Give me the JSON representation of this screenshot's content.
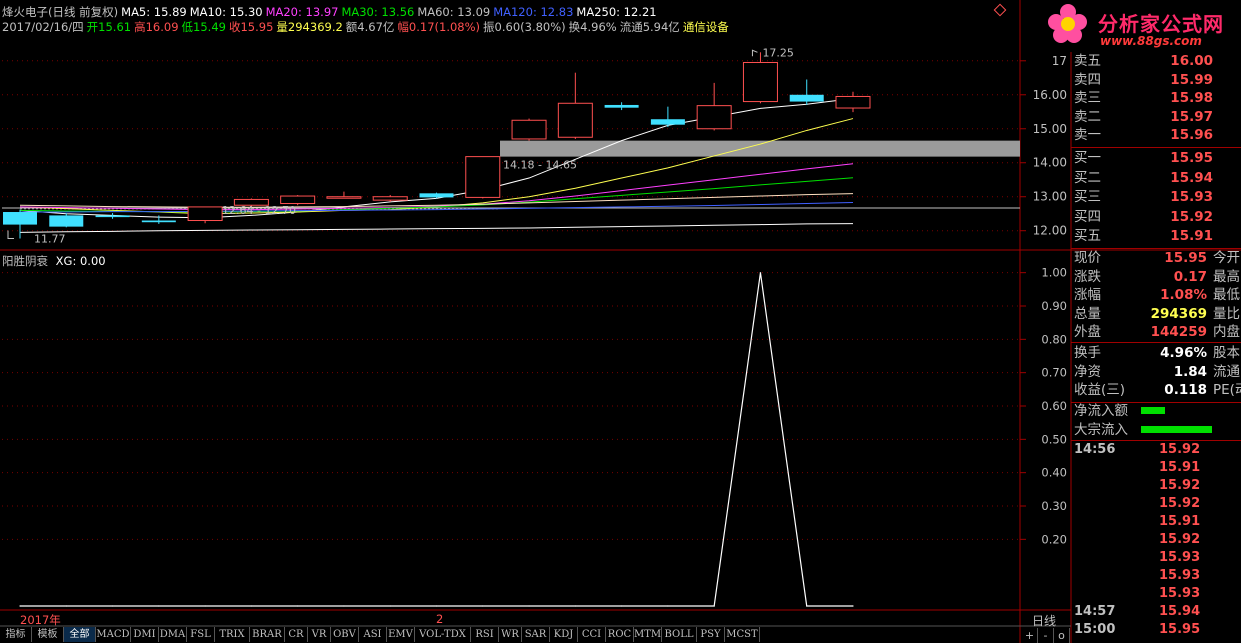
{
  "header": {
    "line1": [
      {
        "text": "烽火电子(日线 前复权)",
        "color": "#c0c0c0"
      },
      {
        "text": "MA5: 15.89",
        "color": "#ffffff"
      },
      {
        "text": "MA10: 15.30",
        "color": "#ffffff"
      },
      {
        "text": "MA20: 13.97",
        "color": "#ff40ff"
      },
      {
        "text": "MA30: 13.56",
        "color": "#00e000"
      },
      {
        "text": "MA60: 13.09",
        "color": "#c0c0c0"
      },
      {
        "text": "MA120: 12.83",
        "color": "#4060ff"
      },
      {
        "text": "MA250: 12.21",
        "color": "#ffffff"
      }
    ],
    "line2": [
      {
        "text": "2017/02/16/四",
        "color": "#c0c0c0"
      },
      {
        "text": "开15.61",
        "color": "#00e000"
      },
      {
        "text": "高16.09",
        "color": "#ff5050"
      },
      {
        "text": "低15.49",
        "color": "#00e000"
      },
      {
        "text": "收15.95",
        "color": "#ff5050"
      },
      {
        "text": "量294369.2",
        "color": "#ffff50"
      },
      {
        "text": "额4.67亿",
        "color": "#c0c0c0"
      },
      {
        "text": "幅0.17(1.08%)",
        "color": "#ff5050"
      },
      {
        "text": "振0.60(3.80%)",
        "color": "#c0c0c0"
      },
      {
        "text": "换4.96%",
        "color": "#c0c0c0"
      },
      {
        "text": "流通5.94亿",
        "color": "#c0c0c0"
      },
      {
        "text": "通信设备",
        "color": "#ffff50"
      }
    ]
  },
  "logo": {
    "title": "分析家公式网",
    "url": "www.88gs.com"
  },
  "price_chart": {
    "ylim": [
      11.55,
      17.7
    ],
    "y_ticks": [
      "17",
      "16.00",
      "15.00",
      "14.00",
      "13.00",
      "12.00"
    ],
    "y_tick_values": [
      17,
      16,
      15,
      14,
      13,
      12
    ],
    "annotations": {
      "high": "17.25",
      "low": "11.77",
      "zone1": "14.18 - 14.65",
      "zone2": "12.64 - 12.70"
    },
    "zone_upper": [
      14.18,
      14.65
    ],
    "zone_lower": [
      12.64,
      12.7
    ],
    "ref_line": 12.67,
    "candles": [
      {
        "o": 12.55,
        "h": 12.62,
        "l": 11.77,
        "c": 12.18
      },
      {
        "o": 12.45,
        "h": 12.52,
        "l": 12.1,
        "c": 12.12
      },
      {
        "o": 12.45,
        "h": 12.52,
        "l": 12.35,
        "c": 12.4
      },
      {
        "o": 12.3,
        "h": 12.45,
        "l": 12.2,
        "c": 12.25
      },
      {
        "o": 12.3,
        "h": 12.7,
        "l": 12.22,
        "c": 12.7
      },
      {
        "o": 12.75,
        "h": 12.95,
        "l": 12.7,
        "c": 12.92
      },
      {
        "o": 12.8,
        "h": 13.05,
        "l": 12.75,
        "c": 13.02
      },
      {
        "o": 13.0,
        "h": 13.15,
        "l": 12.95,
        "c": 13.0
      },
      {
        "o": 12.9,
        "h": 13.05,
        "l": 12.85,
        "c": 13.0
      },
      {
        "o": 13.1,
        "h": 13.12,
        "l": 12.95,
        "c": 12.98
      },
      {
        "o": 12.98,
        "h": 14.18,
        "l": 12.95,
        "c": 14.18
      },
      {
        "o": 14.7,
        "h": 15.3,
        "l": 14.65,
        "c": 15.25
      },
      {
        "o": 14.75,
        "h": 16.65,
        "l": 14.7,
        "c": 15.75
      },
      {
        "o": 15.7,
        "h": 15.78,
        "l": 15.55,
        "c": 15.62
      },
      {
        "o": 15.28,
        "h": 15.65,
        "l": 15.05,
        "c": 15.12
      },
      {
        "o": 15.0,
        "h": 16.35,
        "l": 14.95,
        "c": 15.68
      },
      {
        "o": 15.8,
        "h": 17.25,
        "l": 15.75,
        "c": 16.95
      },
      {
        "o": 16.0,
        "h": 16.45,
        "l": 15.7,
        "c": 15.8
      },
      {
        "o": 15.61,
        "h": 16.09,
        "l": 15.49,
        "c": 15.95
      }
    ],
    "ma": [
      {
        "name": "MA5",
        "color": "#ffffff",
        "values": [
          12.6,
          12.5,
          12.45,
          12.4,
          12.38,
          12.45,
          12.55,
          12.7,
          12.85,
          12.95,
          13.2,
          13.55,
          14.1,
          14.65,
          15.1,
          15.35,
          15.6,
          15.72,
          15.89
        ]
      },
      {
        "name": "MA10",
        "color": "#ffff50",
        "values": [
          12.7,
          12.65,
          12.6,
          12.55,
          12.5,
          12.52,
          12.55,
          12.6,
          12.62,
          12.7,
          12.82,
          13.0,
          13.25,
          13.55,
          13.85,
          14.2,
          14.55,
          14.95,
          15.3
        ]
      },
      {
        "name": "MA20",
        "color": "#ff40ff",
        "values": [
          12.7,
          12.68,
          12.66,
          12.64,
          12.62,
          12.62,
          12.64,
          12.66,
          12.68,
          12.72,
          12.78,
          12.88,
          13.02,
          13.18,
          13.34,
          13.5,
          13.66,
          13.82,
          13.97
        ]
      },
      {
        "name": "MA30",
        "color": "#00e000",
        "values": [
          12.6,
          12.58,
          12.57,
          12.56,
          12.55,
          12.56,
          12.58,
          12.62,
          12.66,
          12.7,
          12.76,
          12.84,
          12.94,
          13.04,
          13.14,
          13.24,
          13.35,
          13.45,
          13.56
        ]
      },
      {
        "name": "MA60",
        "color": "#ffe0c0",
        "values": [
          12.75,
          12.73,
          12.71,
          12.7,
          12.69,
          12.69,
          12.7,
          12.71,
          12.73,
          12.75,
          12.78,
          12.82,
          12.86,
          12.9,
          12.94,
          12.98,
          13.02,
          13.06,
          13.09
        ]
      },
      {
        "name": "MA120",
        "color": "#4060ff",
        "values": [
          12.55,
          12.55,
          12.56,
          12.56,
          12.57,
          12.58,
          12.59,
          12.6,
          12.61,
          12.62,
          12.64,
          12.66,
          12.68,
          12.7,
          12.72,
          12.74,
          12.77,
          12.8,
          12.83
        ]
      },
      {
        "name": "MA250",
        "color": "#ffffff",
        "values": [
          11.95,
          11.97,
          11.98,
          12.0,
          12.01,
          12.02,
          12.03,
          12.04,
          12.05,
          12.06,
          12.07,
          12.08,
          12.1,
          12.12,
          12.14,
          12.16,
          12.18,
          12.2,
          12.21
        ]
      }
    ]
  },
  "indicator": {
    "title": "阳胜阴衰",
    "xg_label": "XG: 0.00",
    "ylim": [
      0,
      1.05
    ],
    "y_ticks": [
      "1.00",
      "0.90",
      "0.80",
      "0.70",
      "0.60",
      "0.50",
      "0.40",
      "0.30",
      "0.20"
    ],
    "y_tick_values": [
      1.0,
      0.9,
      0.8,
      0.7,
      0.6,
      0.5,
      0.4,
      0.3,
      0.2
    ],
    "values": [
      0,
      0,
      0,
      0,
      0,
      0,
      0,
      0,
      0,
      0,
      0,
      0,
      0,
      0,
      0,
      0,
      1,
      0,
      0
    ]
  },
  "time_axis": {
    "year": "2017年",
    "month": "2",
    "period": "日线"
  },
  "tabs": [
    "指标",
    "模板",
    "全部",
    "MACD",
    "DMI",
    "DMA",
    "FSL",
    "TRIX",
    "BRAR",
    "CR",
    "VR",
    "OBV",
    "ASI",
    "EMV",
    "VOL-TDX",
    "RSI",
    "WR",
    "SAR",
    "KDJ",
    "CCI",
    "ROC",
    "MTM",
    "BOLL",
    "PSY",
    "MCST"
  ],
  "active_tab": "全部",
  "bottom_controls": [
    "+",
    "-",
    "o"
  ],
  "order_book": {
    "sell": [
      {
        "label": "卖五",
        "price": "16.00"
      },
      {
        "label": "卖四",
        "price": "15.99"
      },
      {
        "label": "卖三",
        "price": "15.98"
      },
      {
        "label": "卖二",
        "price": "15.97"
      },
      {
        "label": "卖一",
        "price": "15.96"
      }
    ],
    "buy": [
      {
        "label": "买一",
        "price": "15.95"
      },
      {
        "label": "买二",
        "price": "15.94"
      },
      {
        "label": "买三",
        "price": "15.93"
      },
      {
        "label": "买四",
        "price": "15.92"
      },
      {
        "label": "买五",
        "price": "15.91"
      }
    ]
  },
  "stats": [
    {
      "label": "现价",
      "value": "15.95",
      "color": "#ff5050",
      "ext": "今开"
    },
    {
      "label": "涨跌",
      "value": "0.17",
      "color": "#ff5050",
      "ext": "最高"
    },
    {
      "label": "涨幅",
      "value": "1.08%",
      "color": "#ff5050",
      "ext": "最低"
    },
    {
      "label": "总量",
      "value": "294369",
      "color": "#ffff50",
      "ext": "量比"
    },
    {
      "label": "外盘",
      "value": "144259",
      "color": "#ff5050",
      "ext": "内盘"
    }
  ],
  "stats2": [
    {
      "label": "换手",
      "value": "4.96%",
      "color": "#ffffff",
      "ext": "股本"
    },
    {
      "label": "净资",
      "value": "1.84",
      "color": "#ffffff",
      "ext": "流通"
    },
    {
      "label": "收益(三)",
      "value": "0.118",
      "color": "#ffffff",
      "ext": "PE(动)"
    }
  ],
  "flows": [
    {
      "label": "净流入额",
      "bar_fraction": 0.28,
      "color": "#00e000"
    },
    {
      "label": "大宗流入",
      "bar_fraction": 0.85,
      "color": "#00e000"
    }
  ],
  "ticks": [
    {
      "time": "14:56",
      "price": "15.92"
    },
    {
      "time": "",
      "price": "15.91"
    },
    {
      "time": "",
      "price": "15.92"
    },
    {
      "time": "",
      "price": "15.92"
    },
    {
      "time": "",
      "price": "15.91"
    },
    {
      "time": "",
      "price": "15.92"
    },
    {
      "time": "",
      "price": "15.93"
    },
    {
      "time": "",
      "price": "15.93"
    },
    {
      "time": "",
      "price": "15.93"
    },
    {
      "time": "14:57",
      "price": "15.94"
    },
    {
      "time": "15:00",
      "price": "15.95"
    }
  ],
  "colors": {
    "up": "#ff5050",
    "down": "#40e0ff",
    "border": "#a00000",
    "grid": "#7a0000"
  }
}
